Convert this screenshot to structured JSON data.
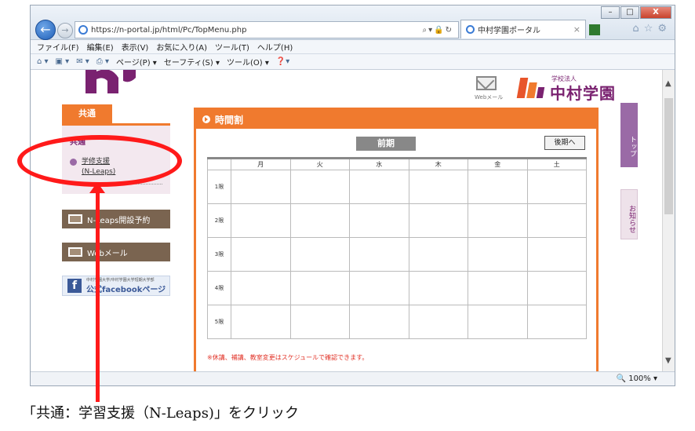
{
  "browser": {
    "url": "https://n-portal.jp/html/Pc/TopMenu.php",
    "tab_title": "中村学園ポータル",
    "tab_close": "×",
    "menu": [
      "ファイル(F)",
      "編集(E)",
      "表示(V)",
      "お気に入り(A)",
      "ツール(T)",
      "ヘルプ(H)"
    ],
    "commands": [
      "ページ(P) ▾",
      "セーフティ(S) ▾",
      "ツール(O) ▾"
    ],
    "zoom": "100%",
    "window_buttons": {
      "minimize": "–",
      "maximize": "□",
      "close": "X"
    },
    "back_glyph": "←",
    "fwd_glyph": "→"
  },
  "header": {
    "mail_label": "Webメール",
    "school_sub": "学校法人",
    "school_name": "中村学園"
  },
  "side_tabs": {
    "top": "トップ",
    "news": "お知らせ"
  },
  "left_menu": {
    "tab_label": "共通",
    "category": "共通",
    "item_line1": "学修支援",
    "item_line2": "(N-Leaps)",
    "btn_nleaps": "N-Leaps開設予約",
    "btn_webmail": "Webメール",
    "fb_small": "中村学園大学/中村学園大学短期大学部",
    "fb_big": "公式facebookページ"
  },
  "timetable": {
    "title": "時間割",
    "term": "前期",
    "later_button": "後期へ",
    "days": [
      "月",
      "火",
      "水",
      "木",
      "金",
      "土"
    ],
    "periods": [
      "1限",
      "2限",
      "3限",
      "4限",
      "5限"
    ],
    "note": "※休講、補講、教室変更はスケジュールで確認できます。"
  },
  "annotation": {
    "caption": "「共通：学習支援（N-Leaps)」をクリック"
  },
  "colors": {
    "accent": "#f07a2e",
    "brand": "#7a2270",
    "annotation": "#ff1a1a"
  }
}
